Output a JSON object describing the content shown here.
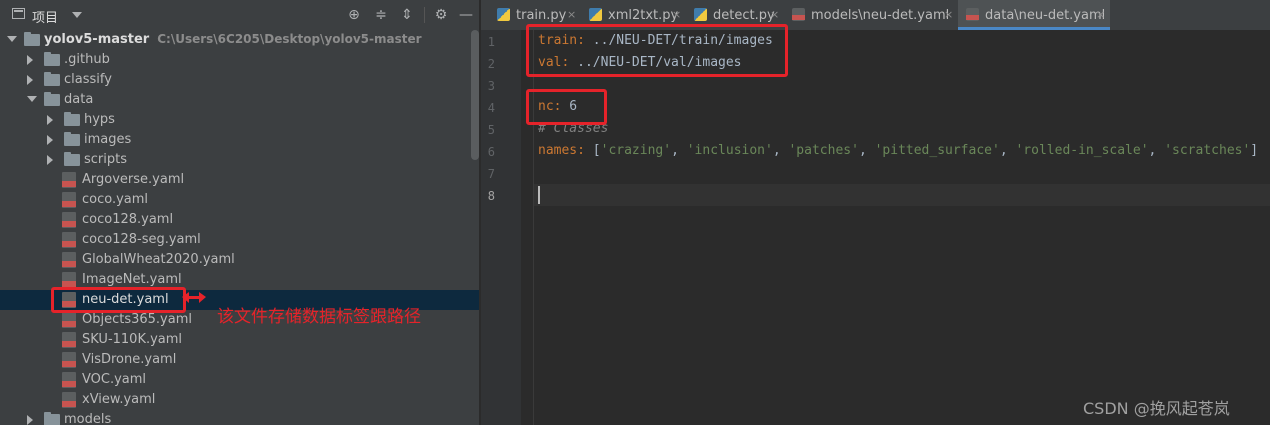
{
  "panel": {
    "title": "项目",
    "root": {
      "name": "yolov5-master",
      "path": "C:\\Users\\6C205\\Desktop\\yolov5-master"
    },
    "folders": [
      ".github",
      "classify",
      "data",
      "hyps",
      "images",
      "scripts"
    ],
    "data_files": [
      "Argoverse.yaml",
      "coco.yaml",
      "coco128.yaml",
      "coco128-seg.yaml",
      "GlobalWheat2020.yaml",
      "ImageNet.yaml",
      "neu-det.yaml",
      "Objects365.yaml",
      "SKU-110K.yaml",
      "VisDrone.yaml",
      "VOC.yaml",
      "xView.yaml"
    ],
    "last_folder": "models"
  },
  "annotation_text": "该文件存储数据标签跟路径",
  "tabs": [
    {
      "label": "train.py",
      "type": "py"
    },
    {
      "label": "xml2txt.py",
      "type": "py"
    },
    {
      "label": "detect.py",
      "type": "py"
    },
    {
      "label": "models\\neu-det.yaml",
      "type": "yaml"
    },
    {
      "label": "data\\neu-det.yaml",
      "type": "yaml",
      "active": true
    }
  ],
  "close_glyph": "×",
  "line_numbers": [
    "1",
    "2",
    "3",
    "4",
    "5",
    "6",
    "7",
    "8"
  ],
  "code": {
    "train_key": "train",
    "train_val": " ../NEU-DET/train/images",
    "val_key": "val",
    "val_val": " ../NEU-DET/val/images",
    "nc_key": "nc",
    "nc_val": " 6",
    "comment": "# Classes",
    "names_key": "names",
    "names_open": " [",
    "names_items": [
      "'crazing'",
      "'inclusion'",
      "'patches'",
      "'pitted_surface'",
      "'rolled-in_scale'",
      "'scratches'"
    ],
    "names_close": "]",
    "colon": ":",
    "comma": ", "
  },
  "watermark": "CSDN @挽风起苍岚",
  "colors": {
    "keyword": "#cc7832",
    "string": "#6a8759",
    "comment": "#808080",
    "annotation": "#e5232a",
    "selection": "#0d293e"
  }
}
